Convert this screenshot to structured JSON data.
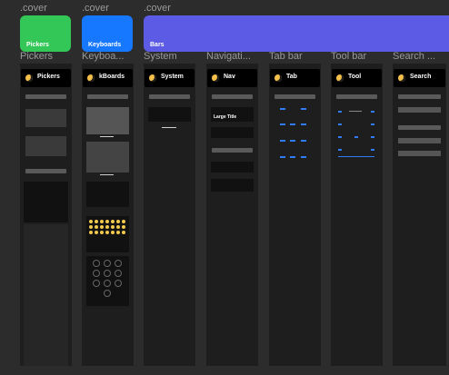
{
  "top_labels": [
    ".cover",
    ".cover",
    ".cover"
  ],
  "covers": [
    {
      "label": "Pickers",
      "color": "#33c758"
    },
    {
      "label": "Keyboards",
      "color": "#1677ff"
    },
    {
      "label": "Bars",
      "color": "#5b5be6"
    }
  ],
  "frame_labels": [
    "Pickers",
    "Keyboa...",
    "System",
    "Navigati...",
    "Tab bar",
    "Tool bar",
    "Search ..."
  ],
  "frame_titles": [
    "Pickers",
    "kBoards",
    "System",
    "Nav",
    "Tab",
    "Tool",
    "Search"
  ],
  "nav_large_title": "Large Title",
  "colors": {
    "bg": "#2c2c2c",
    "frame": "#1e1e1e",
    "accent_blue": "#2f7cf6"
  }
}
